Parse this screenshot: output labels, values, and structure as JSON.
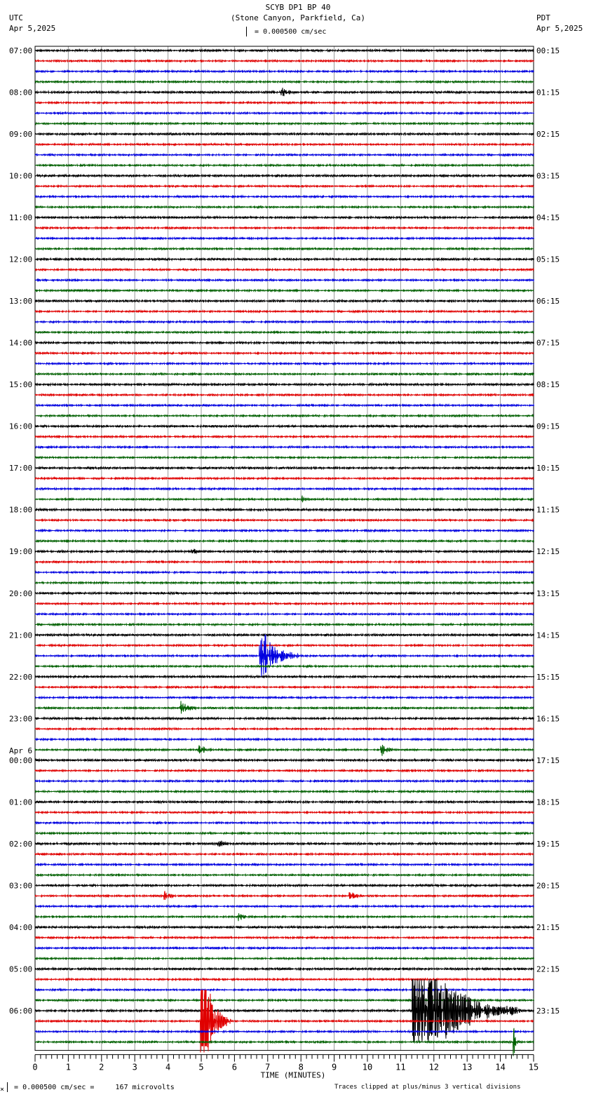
{
  "header": {
    "title": "SCYB DP1 BP 40",
    "subtitle": "(Stone Canyon, Parkfield, Ca)",
    "left_tz": "UTC",
    "left_date": "Apr 5,2025",
    "right_tz": "PDT",
    "right_date": "Apr 5,2025",
    "scale_label": "= 0.000500 cm/sec"
  },
  "footer": {
    "scale_note": "= 0.000500 cm/sec =     167 microvolts",
    "clip_note": "Traces clipped at plus/minus 3 vertical divisions",
    "marker": "×"
  },
  "chart_data": {
    "type": "line",
    "title": "SCYB DP1 BP 40",
    "xlabel": "TIME (MINUTES)",
    "xlim": [
      0,
      15
    ],
    "x_ticks": [
      "0",
      "1",
      "2",
      "3",
      "4",
      "5",
      "6",
      "7",
      "8",
      "9",
      "10",
      "11",
      "12",
      "13",
      "14",
      "15"
    ],
    "traces_per_row_hour": 4,
    "trace_colors": [
      "#000000",
      "#e00000",
      "#0000e0",
      "#006000"
    ],
    "clip_divisions": 3,
    "date_change_label": "Apr 6",
    "left_labels": [
      "07:00",
      "08:00",
      "09:00",
      "10:00",
      "11:00",
      "12:00",
      "13:00",
      "14:00",
      "15:00",
      "16:00",
      "17:00",
      "18:00",
      "19:00",
      "20:00",
      "21:00",
      "22:00",
      "23:00",
      "00:00",
      "01:00",
      "02:00",
      "03:00",
      "04:00",
      "05:00",
      "06:00"
    ],
    "right_labels": [
      "00:15",
      "01:15",
      "02:15",
      "03:15",
      "04:15",
      "05:15",
      "06:15",
      "07:15",
      "08:15",
      "09:15",
      "10:15",
      "11:15",
      "12:15",
      "13:15",
      "14:15",
      "15:15",
      "16:15",
      "17:15",
      "18:15",
      "19:15",
      "20:15",
      "21:15",
      "22:15",
      "23:15"
    ],
    "events": [
      {
        "trace": 4,
        "start_min": 7.4,
        "duration_min": 0.6,
        "amplitude_div": 0.35
      },
      {
        "trace": 43,
        "start_min": 8.0,
        "duration_min": 0.3,
        "amplitude_div": 0.3
      },
      {
        "trace": 48,
        "start_min": 4.7,
        "duration_min": 0.3,
        "amplitude_div": 0.3
      },
      {
        "trace": 58,
        "start_min": 6.75,
        "duration_min": 1.3,
        "amplitude_div": 2.4
      },
      {
        "trace": 63,
        "start_min": 4.35,
        "duration_min": 0.6,
        "amplitude_div": 0.6
      },
      {
        "trace": 67,
        "start_min": 4.9,
        "duration_min": 0.5,
        "amplitude_div": 0.5
      },
      {
        "trace": 67,
        "start_min": 10.4,
        "duration_min": 0.4,
        "amplitude_div": 0.6
      },
      {
        "trace": 76,
        "start_min": 5.5,
        "duration_min": 0.5,
        "amplitude_div": 0.3
      },
      {
        "trace": 81,
        "start_min": 3.85,
        "duration_min": 0.4,
        "amplitude_div": 0.5
      },
      {
        "trace": 81,
        "start_min": 9.45,
        "duration_min": 0.4,
        "amplitude_div": 0.5
      },
      {
        "trace": 83,
        "start_min": 6.1,
        "duration_min": 0.4,
        "amplitude_div": 0.35
      },
      {
        "trace": 92,
        "start_min": 11.33,
        "duration_min": 3.3,
        "amplitude_div": 6
      },
      {
        "trace": 93,
        "start_min": 4.97,
        "duration_min": 0.9,
        "amplitude_div": 6
      },
      {
        "trace": 95,
        "start_min": 14.38,
        "duration_min": 0.15,
        "amplitude_div": 2
      }
    ]
  }
}
